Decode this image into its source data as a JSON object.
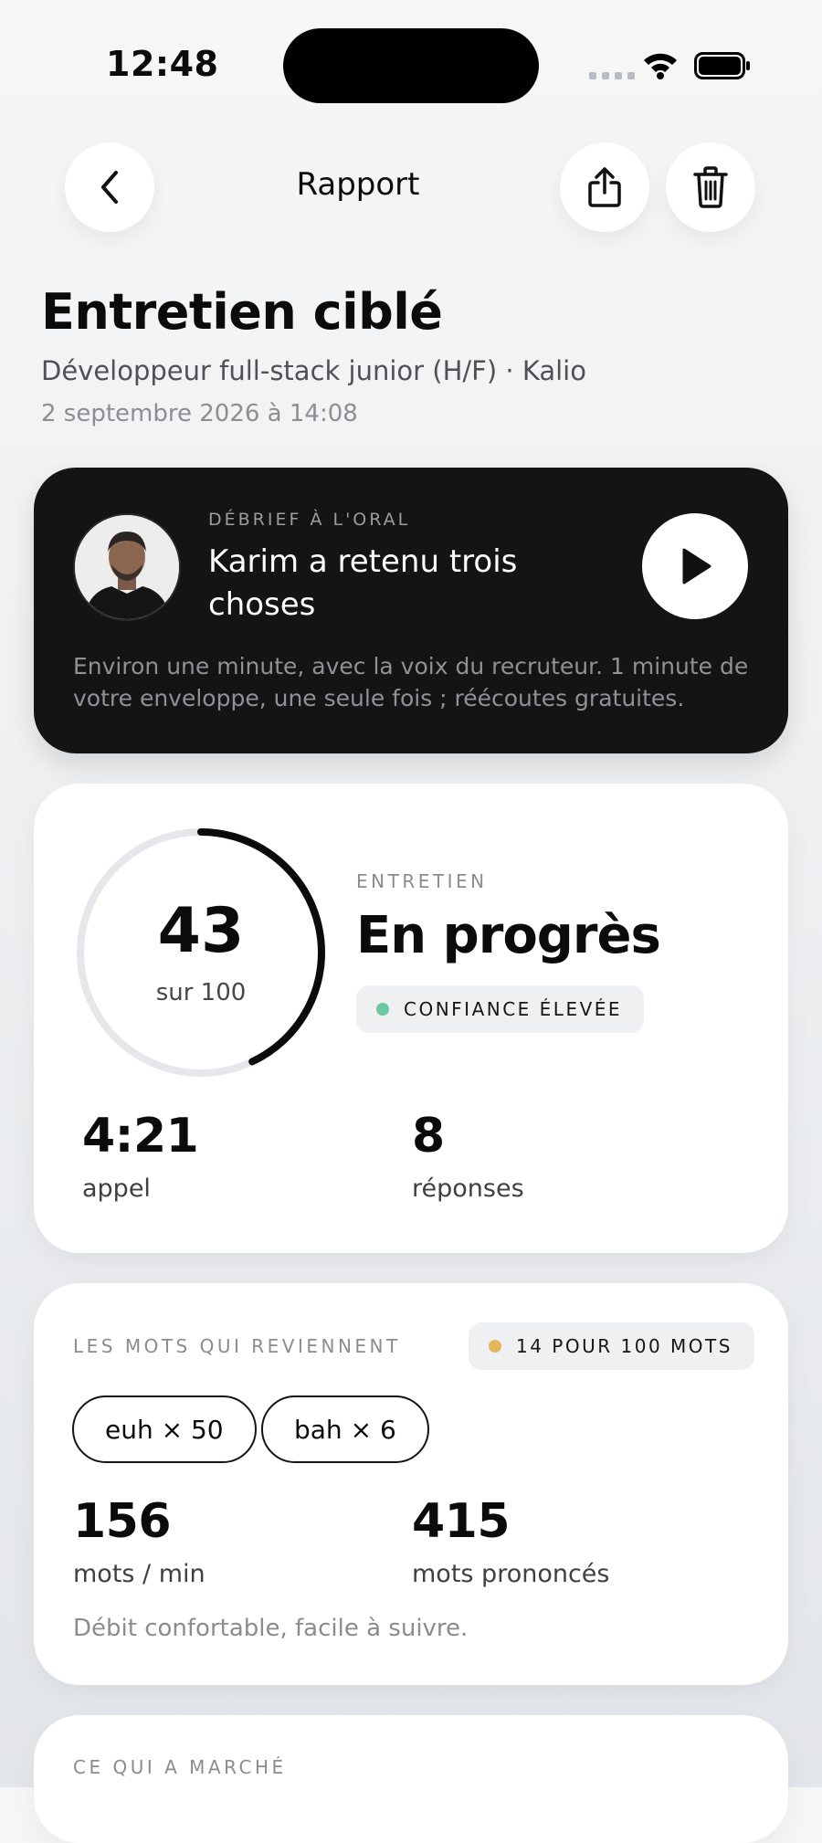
{
  "status_bar": {
    "time": "12:48"
  },
  "nav": {
    "title": "Rapport"
  },
  "header": {
    "title": "Entretien ciblé",
    "subtitle": "Développeur full-stack junior (H/F) · Kalio",
    "date": "2 septembre 2026 à 14:08"
  },
  "audio_card": {
    "overline": "DÉBRIEF À L'ORAL",
    "title": "Karim a retenu trois choses",
    "description": "Environ une minute, avec la voix du recruteur. 1 minute de votre enveloppe, une seule fois ; réécoutes gratuites."
  },
  "score_card": {
    "score": "43",
    "score_suffix": "sur 100",
    "score_fraction": 0.43,
    "overline": "ENTRETIEN",
    "level": "En progrès",
    "confidence_badge": "CONFIANCE ÉLEVÉE",
    "confidence_color": "#6cc7a3",
    "stats": [
      {
        "value": "4:21",
        "label": "appel"
      },
      {
        "value": "8",
        "label": "réponses"
      }
    ]
  },
  "words_card": {
    "overline": "LES MOTS QUI REVIENNENT",
    "rate_badge": "14 POUR 100 MOTS",
    "rate_color": "#e6b65e",
    "chips": [
      "euh × 50",
      "bah × 6"
    ],
    "stats": [
      {
        "value": "156",
        "label": "mots / min"
      },
      {
        "value": "415",
        "label": "mots prononcés"
      }
    ],
    "note": "Débit confortable, facile à suivre."
  },
  "next_card": {
    "overline": "CE QUI A MARCHÉ"
  }
}
